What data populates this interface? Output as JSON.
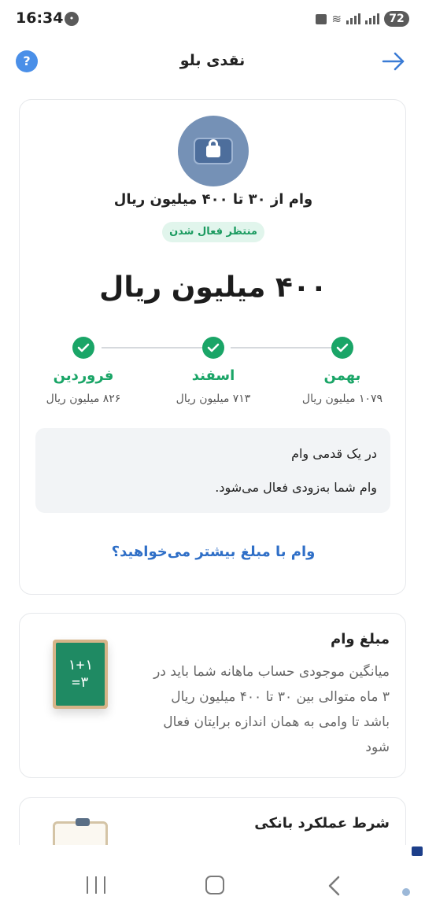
{
  "status_bar": {
    "time": "16:34",
    "battery": "72"
  },
  "header": {
    "title": "نقدی بلو",
    "help_icon_glyph": "?"
  },
  "loan_card": {
    "range_text": "وام از ۳۰ تا ۴۰۰ میلیون ریال",
    "status_badge": "منتظر فعال شدن",
    "amount": "۴۰۰ میلیون ریال",
    "timeline": [
      {
        "month": "بهمن",
        "value": "۱۰۷۹ میلیون ریال",
        "done": true
      },
      {
        "month": "اسفند",
        "value": "۷۱۳ میلیون ریال",
        "done": true
      },
      {
        "month": "فروردین",
        "value": "۸۲۶ میلیون ریال",
        "done": true
      }
    ],
    "info_title": "در یک قدمی وام",
    "info_text": "وام شما به‌زودی فعال می‌شود.",
    "more_link": "وام با مبلغ بیشتر می‌خواهید؟"
  },
  "amount_card": {
    "title": "مبلغ وام",
    "text": "میانگین موجودی حساب ماهانه شما باید در ۳ ماه متوالی بین ۳۰ تا ۴۰۰ میلیون ریال باشد تا وامی به همان اندازه برایتان فعال شود",
    "board_line1": "۱+۱",
    "board_line2": "=۳"
  },
  "bank_card": {
    "title": "شرط عملکرد بانکی"
  },
  "colors": {
    "accent_green": "#1aa567",
    "link_blue": "#2f6fc7",
    "help_blue": "#4a8fe8"
  },
  "icons": [
    "help-icon",
    "arrow-right-icon",
    "lock-icon",
    "check-icon",
    "chalkboard-icon",
    "clipboard-icon"
  ]
}
